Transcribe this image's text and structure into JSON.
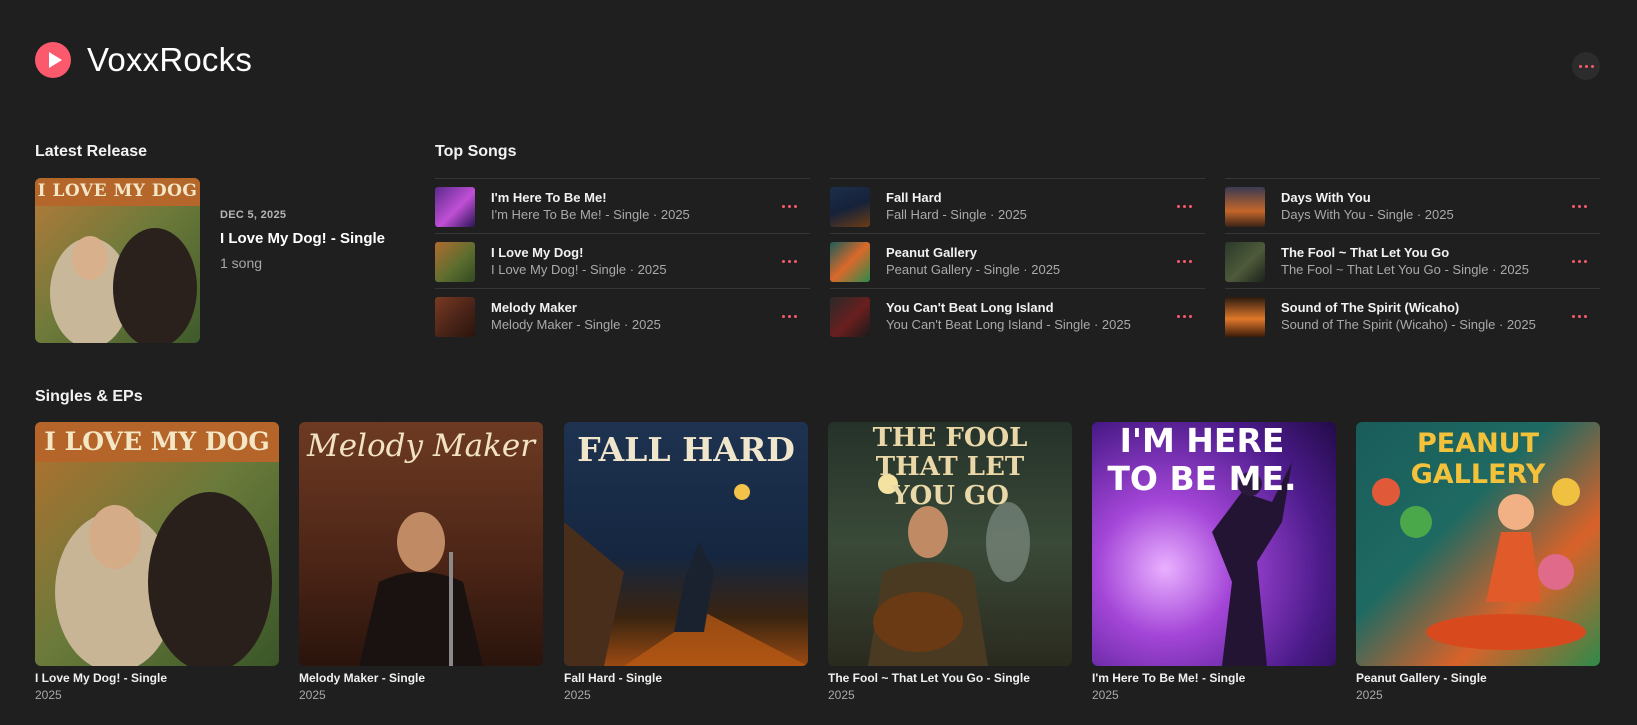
{
  "artist": {
    "name": "VoxxRocks",
    "logo_icon": "play-icon",
    "more_icon": "more-icon"
  },
  "colors": {
    "accent": "#fa5a6c",
    "background": "#1f1f1f",
    "subtext": "#a9a9a9"
  },
  "latest_release": {
    "heading": "Latest Release",
    "date": "DEC 5, 2025",
    "title": "I Love My Dog! - Single",
    "count": "1 song",
    "cover_text": "I LOVE MY DOG"
  },
  "top_songs": {
    "heading": "Top Songs",
    "columns": [
      [
        {
          "title": "I'm Here To Be Me!",
          "subtitle": "I'm Here To Be Me! - Single · 2025",
          "cover": "purple"
        },
        {
          "title": "I Love My Dog!",
          "subtitle": "I Love My Dog! - Single · 2025",
          "cover": "green"
        },
        {
          "title": "Melody Maker",
          "subtitle": "Melody Maker - Single · 2025",
          "cover": "brown"
        }
      ],
      [
        {
          "title": "Fall Hard",
          "subtitle": "Fall Hard - Single · 2025",
          "cover": "navy"
        },
        {
          "title": "Peanut Gallery",
          "subtitle": "Peanut Gallery - Single · 2025",
          "cover": "teal"
        },
        {
          "title": "You Can't Beat Long Island",
          "subtitle": "You Can't Beat Long Island - Single · 2025",
          "cover": "dark"
        }
      ],
      [
        {
          "title": "Days With You",
          "subtitle": "Days With You - Single · 2025",
          "cover": "sunset"
        },
        {
          "title": "The Fool ~ That Let You Go",
          "subtitle": "The Fool ~ That Let You Go - Single · 2025",
          "cover": "olive"
        },
        {
          "title": "Sound of The Spirit (Wicaho)",
          "subtitle": "Sound of The Spirit (Wicaho) - Single · 2025",
          "cover": "fire"
        }
      ]
    ]
  },
  "singles": {
    "heading": "Singles & EPs",
    "items": [
      {
        "title": "I Love My Dog! - Single",
        "year": "2025",
        "cover_text": "I LOVE MY DOG",
        "cover": "green"
      },
      {
        "title": "Melody Maker - Single",
        "year": "2025",
        "cover_text": "Melody Maker",
        "cover": "brown"
      },
      {
        "title": "Fall Hard - Single",
        "year": "2025",
        "cover_text": "FALL HARD",
        "cover": "navy"
      },
      {
        "title": "The Fool ~ That Let You Go - Single",
        "year": "2025",
        "cover_text": "THE FOOL THAT LET YOU GO",
        "cover": "olive"
      },
      {
        "title": "I'm Here To Be Me! - Single",
        "year": "2025",
        "cover_text": "I'M HERE TO BE ME.",
        "cover": "purple"
      },
      {
        "title": "Peanut Gallery - Single",
        "year": "2025",
        "cover_text": "PEANUT GALLERY",
        "cover": "teal"
      }
    ]
  }
}
